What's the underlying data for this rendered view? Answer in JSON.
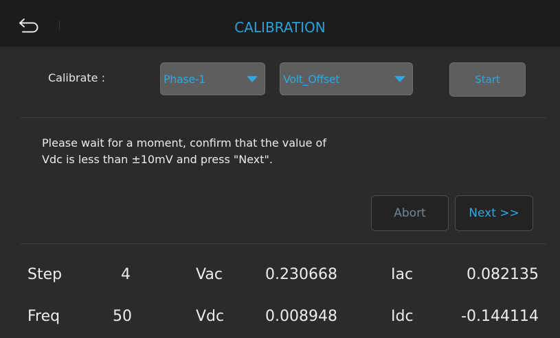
{
  "header": {
    "title": "CALIBRATION",
    "back_icon": "back-arrow-icon"
  },
  "calibrate": {
    "label": "Calibrate :",
    "channel_value": "Phase-1",
    "mode_value": "Volt_Offset",
    "start_label": "Start"
  },
  "message": {
    "text": "Please wait for a moment, confirm that the value of Vdc is less than ±10mV and press \"Next\"."
  },
  "actions": {
    "abort_label": "Abort",
    "next_label": "Next >>"
  },
  "readings": {
    "step_label": "Step",
    "step_value": "4",
    "vac_label": "Vac",
    "vac_value": "0.230668",
    "iac_label": "Iac",
    "iac_value": "0.082135",
    "freq_label": "Freq",
    "freq_value": "50",
    "vdc_label": "Vdc",
    "vdc_value": "0.008948",
    "idc_label": "Idc",
    "idc_value": "-0.144114"
  },
  "colors": {
    "accent": "#2fa8e0",
    "background": "#2b2b2b",
    "titlebar": "#1c1c1c",
    "control": "#5e5e5e"
  }
}
